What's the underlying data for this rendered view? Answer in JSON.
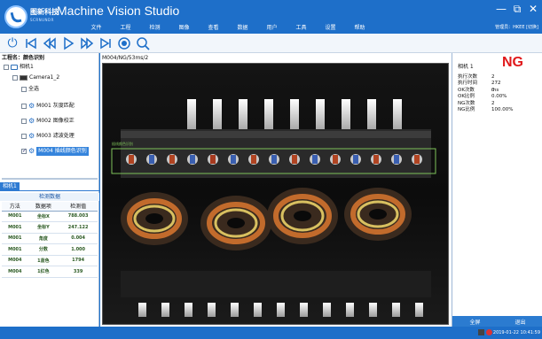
{
  "app": {
    "company": "图新科技",
    "company_sub": "SCRNUNDR",
    "title": "Machine Vision Studio",
    "user_info": "管理员：HKEE  [切换]"
  },
  "menu": [
    "文件",
    "工程",
    "检测",
    "图像",
    "查看",
    "数据",
    "用户",
    "工具",
    "设置",
    "帮助"
  ],
  "window_buttons": [
    "minimize-icon",
    "restore-icon",
    "close-icon"
  ],
  "toolbar": [
    "power-icon",
    "first-icon",
    "prev-icon",
    "play-icon",
    "next-icon",
    "last-icon",
    "record-icon",
    "zoom-icon"
  ],
  "left": {
    "project_name": "工程名：颜色识别",
    "tree": {
      "camera_root": "相机1",
      "camera_child": "Camera1_2",
      "select_all": "全选",
      "modules": [
        {
          "label": "M001 灰度匹配",
          "checked": false
        },
        {
          "label": "M002 图像校正",
          "checked": false
        },
        {
          "label": "M003 滤波处理",
          "checked": false
        },
        {
          "label": "M004 插线颜色识别",
          "checked": true
        }
      ]
    },
    "sub_tab": "相机1",
    "detect_title": "检测数据",
    "columns": [
      "方法",
      "数据项",
      "检测值"
    ],
    "rows": [
      [
        "M001",
        "坐标X",
        "788.003"
      ],
      [
        "M001",
        "坐标Y",
        "247.122"
      ],
      [
        "M001",
        "角度",
        "0.004"
      ],
      [
        "M001",
        "分数",
        "1.000"
      ],
      [
        "M004",
        "1蓝色",
        "1794"
      ],
      [
        "M004",
        "1红色",
        "339"
      ]
    ]
  },
  "image": {
    "label": "M004/NG/53ms/2",
    "roi_label": "插线颜色识别"
  },
  "right": {
    "camera": "相机 1",
    "result": "NG",
    "stats": [
      {
        "k": "执行次数",
        "v": "2"
      },
      {
        "k": "执行时间",
        "v": "272 ms"
      },
      {
        "k": "OK次数",
        "v": "0"
      },
      {
        "k": "OK比例",
        "v": "0.00%"
      },
      {
        "k": "NG次数",
        "v": "2"
      },
      {
        "k": "NG比例",
        "v": "100.00%"
      }
    ],
    "footer": [
      "全屏",
      "退出"
    ]
  },
  "status": {
    "datetime": "2019-01-22 10:41:59"
  }
}
